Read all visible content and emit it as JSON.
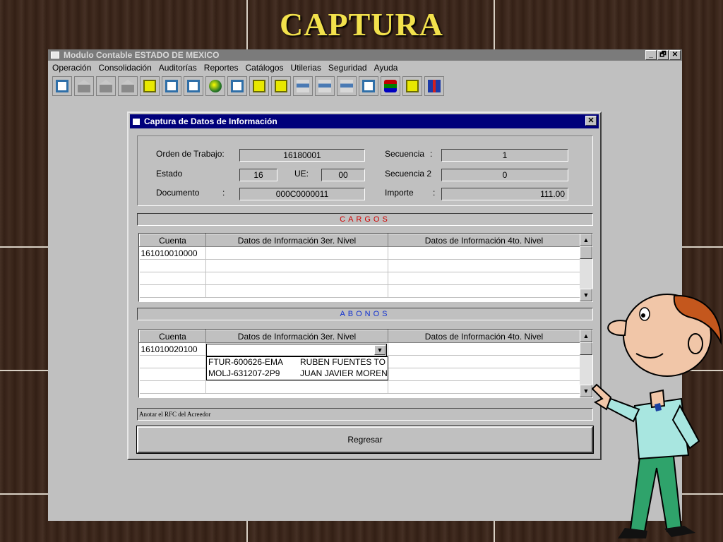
{
  "slide": {
    "title": "CAPTURA"
  },
  "app": {
    "title": "Modulo Contable ESTADO DE MEXICO",
    "window_buttons": {
      "minimize": "_",
      "restore": "🗗",
      "close": "✕"
    },
    "menu": [
      "Operación",
      "Consolidación",
      "Auditorías",
      "Reportes",
      "Catálogos",
      "Utilerias",
      "Seguridad",
      "Ayuda"
    ],
    "toolbar_icons": [
      "building-icon",
      "building-icon",
      "building-icon",
      "building-icon",
      "card-icon",
      "screen-icon",
      "disk-icon",
      "globe-icon",
      "screen-icon",
      "card-icon",
      "card-icon",
      "scale-icon",
      "network-icon",
      "network-icon",
      "calendar-icon",
      "books-icon",
      "card-icon",
      "help-icon"
    ]
  },
  "dialog": {
    "title": "Captura de Datos de Información",
    "close": "✕",
    "fields": {
      "orden_label": "Orden de Trabajo:",
      "orden_value": "16180001",
      "estado_label": "Estado",
      "estado_value": "16",
      "ue_label": "UE:",
      "ue_value": "00",
      "documento_label": "Documento",
      "documento_colon": ":",
      "documento_value": "000C0000011",
      "secuencia_label": "Secuencia",
      "secuencia_colon": ":",
      "secuencia_value": "1",
      "secuencia2_label": "Secuencia 2",
      "secuencia2_value": "0",
      "importe_label": "Importe",
      "importe_colon": ":",
      "importe_value": "111.00"
    },
    "cargos": {
      "title": "CARGOS",
      "columns": [
        "Cuenta",
        "Datos de Información 3er. Nivel",
        "Datos de Información 4to. Nivel"
      ],
      "rows": [
        [
          "161010010000",
          "",
          ""
        ],
        [
          "",
          "",
          ""
        ],
        [
          "",
          "",
          ""
        ],
        [
          "",
          "",
          ""
        ]
      ]
    },
    "abonos": {
      "title": "ABONOS",
      "columns": [
        "Cuenta",
        "Datos de Información 3er. Nivel",
        "Datos de Información 4to. Nivel"
      ],
      "rows": [
        [
          "161010020100",
          "",
          ""
        ],
        [
          "",
          "",
          ""
        ],
        [
          "",
          "",
          ""
        ],
        [
          "",
          "",
          ""
        ]
      ],
      "dropdown_options": [
        [
          "FTUR-600626-EMA",
          "RUBEN FUENTES TO"
        ],
        [
          "MOLJ-631207-2P9",
          "JUAN JAVIER MOREN"
        ]
      ]
    },
    "status": "Anotar el RFC del Acreedor",
    "return_button": "Regresar",
    "scroll_up": "▲",
    "scroll_down": "▼",
    "combo_arrow": "▼"
  }
}
